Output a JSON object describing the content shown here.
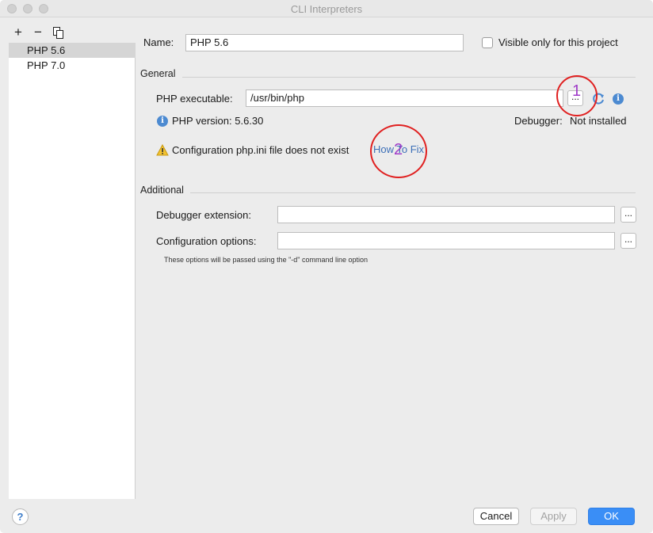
{
  "window": {
    "title": "CLI Interpreters"
  },
  "toolbar": {
    "add_label": "+",
    "remove_label": "−"
  },
  "sidebar": {
    "items": [
      {
        "label": "PHP 5.6",
        "selected": true
      },
      {
        "label": "PHP 7.0",
        "selected": false
      }
    ]
  },
  "form": {
    "name_label": "Name:",
    "name_value": "PHP 5.6",
    "visible_label": "Visible only for this project",
    "general": {
      "title": "General",
      "executable_label": "PHP executable:",
      "executable_value": "/usr/bin/php",
      "browse_label": "...",
      "version_text": "PHP version: 5.6.30",
      "debugger_label": "Debugger:",
      "debugger_value": "Not installed",
      "warning_text": "Configuration php.ini file does not exist",
      "fix_link": "How To Fix"
    },
    "additional": {
      "title": "Additional",
      "debugger_ext_label": "Debugger extension:",
      "debugger_ext_value": "",
      "config_label": "Configuration options:",
      "config_value": "",
      "browse_label": "...",
      "hint": "These options will be passed using the \"-d\" command line option"
    }
  },
  "annotations": {
    "num1": "1",
    "num2": "2"
  },
  "buttons": {
    "help": "?",
    "cancel": "Cancel",
    "apply": "Apply",
    "ok": "OK"
  },
  "colors": {
    "accent": "#3a8ef6",
    "link": "#3c6fb7",
    "annotation_circle": "#e02020",
    "annotation_number": "#a03cc8"
  }
}
